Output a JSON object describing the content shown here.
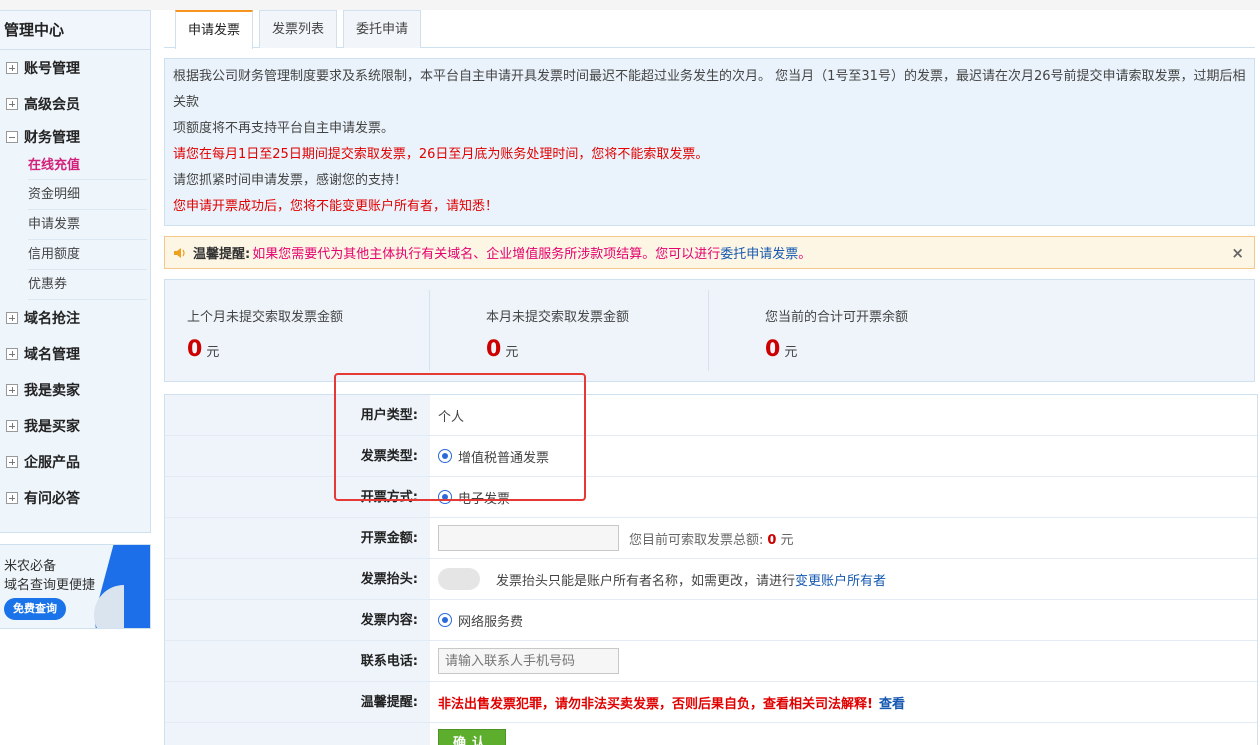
{
  "sidebar": {
    "title": "管理中心",
    "menu": [
      {
        "label": "账号管理",
        "state": "plus"
      },
      {
        "label": "高级会员",
        "state": "plus"
      },
      {
        "label": "财务管理",
        "state": "minus"
      }
    ],
    "submenu": [
      {
        "label": "在线充值",
        "active": true
      },
      {
        "label": "资金明细"
      },
      {
        "label": "申请发票"
      },
      {
        "label": "信用额度"
      },
      {
        "label": "优惠券"
      }
    ],
    "menu2": [
      {
        "label": "域名抢注"
      },
      {
        "label": "域名管理"
      },
      {
        "label": "我是卖家"
      },
      {
        "label": "我是买家"
      },
      {
        "label": "企服产品"
      },
      {
        "label": "有问必答"
      }
    ]
  },
  "ad": {
    "line1": "米农必备",
    "line2": "域名查询更便捷",
    "button": "免费查询"
  },
  "tabs": [
    "申请发票",
    "发票列表",
    "委托申请"
  ],
  "notice": {
    "p1": "根据我公司财务管理制度要求及系统限制，本平台自主申请开具发票时间最迟不能超过业务发生的次月。 您当月（1号至31号）的发票，最迟请在次月26号前提交申请索取发票，过期后相关款",
    "p2": "项额度将不再支持平台自主申请发票。",
    "p3": "请您在每月1日至25日期间提交索取发票，26日至月底为账务处理时间，您将不能索取发票。",
    "p4": "请您抓紧时间申请发票，感谢您的支持！",
    "p5": "您申请开票成功后，您将不能变更账户所有者，请知悉！"
  },
  "tip": {
    "label": "温馨提醒:",
    "text": "如果您需要代为其他主体执行有关域名、企业增值服务所涉款项结算。您可以进行",
    "link": "委托申请发票",
    "end": "。",
    "close": "×"
  },
  "stats": [
    {
      "label": "上个月未提交索取发票金额",
      "value": "0",
      "unit": "元"
    },
    {
      "label": "本月未提交索取发票金额",
      "value": "0",
      "unit": "元"
    },
    {
      "label": "您当前的合计可开票余额",
      "value": "0",
      "unit": "元"
    }
  ],
  "form": {
    "user_type_label": "用户类型:",
    "user_type_value": "个人",
    "invoice_type_label": "发票类型:",
    "invoice_type_value": "增值税普通发票",
    "method_label": "开票方式:",
    "method_value": "电子发票",
    "amount_label": "开票金额:",
    "amount_hint": "您目前可索取发票总额:",
    "amount_total": "0",
    "amount_unit": "元",
    "title_label": "发票抬头:",
    "title_hint": "发票抬头只能是账户所有者名称，如需更改，请进行",
    "title_link": "变更账户所有者",
    "content_label": "发票内容:",
    "content_value": "网络服务费",
    "phone_label": "联系电话:",
    "phone_placeholder": "请输入联系人手机号码",
    "warn_label": "温馨提醒:",
    "warn_text": "非法出售发票犯罪，请勿非法买卖发票，否则后果自负，查看相关司法解释!",
    "warn_link": "查看",
    "submit": "确认"
  }
}
